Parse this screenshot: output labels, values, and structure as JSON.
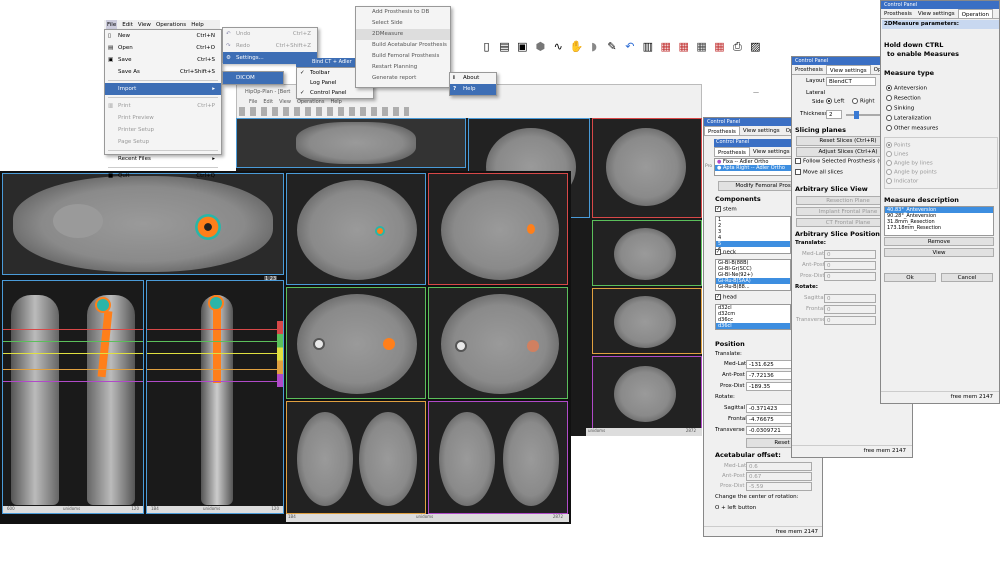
{
  "file_menu": {
    "bar": [
      "File",
      "Edit",
      "View",
      "Operations",
      "Help"
    ],
    "items": [
      {
        "label": "New",
        "shortcut": "Ctrl+N",
        "icon": "new-icon"
      },
      {
        "label": "Open",
        "shortcut": "Ctrl+O",
        "icon": "open-icon"
      },
      {
        "label": "Save",
        "shortcut": "Ctrl+S",
        "icon": "save-icon"
      },
      {
        "label": "Save As",
        "shortcut": "Ctrl+Shift+S"
      },
      {
        "label": "Import",
        "arrow": "▸"
      },
      {
        "label": "Print",
        "shortcut": "Ctrl+P"
      },
      {
        "label": "Print Preview"
      },
      {
        "label": "Printer Setup"
      },
      {
        "label": "Page Setup"
      },
      {
        "label": "Recent Files",
        "arrow": "▸"
      },
      {
        "label": "Quit",
        "shortcut": "Ctrl+Q"
      }
    ],
    "import_sub": "DICOM"
  },
  "edit_menu": {
    "items": [
      {
        "label": "Undo",
        "shortcut": "Ctrl+Z"
      },
      {
        "label": "Redo",
        "shortcut": "Ctrl+Shift+Z"
      },
      {
        "label": "Settings..."
      }
    ]
  },
  "view_menu": {
    "items": [
      "Toolbar",
      "Log Panel",
      "Control Panel"
    ],
    "window_title_fragment": "Bind CT + Adler"
  },
  "operations_menu": {
    "items": [
      "Add Prosthesis to DB",
      "Select Side",
      "2DMeasure",
      "Build Acetabular Prosthesis",
      "Build Femoral Prosthesis",
      "Restart Planning",
      "Generate report"
    ]
  },
  "help_menu": {
    "items": [
      "About",
      "Help"
    ]
  },
  "small_window": {
    "title": "HipOp-Plan - [Bert",
    "menubar": [
      "File",
      "Edit",
      "View",
      "Operations",
      "Help"
    ]
  },
  "main_view": {
    "slider_value": "1 23",
    "status": [
      {
        "left": "600",
        "center": "unidoms",
        "right": "120"
      },
      {
        "left": "1B4",
        "center": "unidoms",
        "right": "120"
      },
      {
        "left": "1B4",
        "center": "unidoms",
        "right": "2872"
      }
    ],
    "colors": {
      "prosthesis": "#ff7f1a",
      "cup": "#2ab5a8",
      "frame_blue": "#4a9bd8",
      "frame_red": "#d84848",
      "frame_green": "#5bbf5b",
      "frame_purple": "#b04ac8",
      "frame_orange": "#e0a040"
    }
  },
  "mid_panel": {
    "title": "Control Panel",
    "tabs": [
      "Prosthesis",
      "View settings",
      "Operation"
    ],
    "inner_tabs": [
      "Prosthesis",
      "View settings",
      "Op"
    ],
    "prosthesis_list": [
      "Fixa -- Adler Ortho",
      "Apta Right -- Adler Ortho"
    ],
    "modify_button": "Modify Femoral Prosthes",
    "components_header": "Components",
    "stem_label": "stem",
    "stem_items": [
      "1",
      "2",
      "3",
      "4",
      "5",
      "6"
    ],
    "neck_label": "neck",
    "neck_items": [
      "Gi-Bl-B(88B)",
      "Gi-Bl-Gr(SCC)",
      "Gi-Bl-Ne(92+)",
      "Gi-Ru-B(SAA)",
      "Gi-Ru-B(88..."
    ],
    "head_label": "head",
    "head_items": [
      "d32cl",
      "d32cm",
      "d36cc",
      "d36cl"
    ],
    "position_header": "Position",
    "translate_label": "Translate:",
    "translate": [
      {
        "label": "Med-Lat",
        "value": "-131.625"
      },
      {
        "label": "Ant-Post",
        "value": "-7.72136"
      },
      {
        "label": "Prox-Dist",
        "value": "-189.35"
      }
    ],
    "rotate_label": "Rotate:",
    "rotate": [
      {
        "label": "Sagittal",
        "value": "-0.371423"
      },
      {
        "label": "Frontal",
        "value": "-4.76675"
      },
      {
        "label": "Transverse",
        "value": "-0.0309721"
      }
    ],
    "reset": "Reset",
    "offset_header": "Acetabular offset:",
    "offset": [
      {
        "label": "Med-Lat",
        "value": "0.6"
      },
      {
        "label": "Ant-Post",
        "value": "0.67"
      },
      {
        "label": "Prox-Dist",
        "value": "-5.59"
      }
    ],
    "change_label": "Change the center of rotation:",
    "change_hint": "O + left button",
    "free_mem": "free mem 2147",
    "side_letters": [
      "Pro",
      "Tra",
      "Rot",
      "Acet",
      "T(1"
    ]
  },
  "slicing_panel": {
    "title": "Control Panel",
    "tabs": [
      "Prosthesis",
      "View settings",
      "Operatio"
    ],
    "layout_label": "Layout",
    "layout_value": "BlendCT",
    "lateral_label": "Lateral",
    "side_label": "Side",
    "left": "Left",
    "right": "Right",
    "thickness_label": "Thickness",
    "thickness_value": "2",
    "slicing_header": "Slicing planes",
    "reset_slices": "Reset Slices (Ctrl+R)",
    "adjust_slices": "Adjust Slices (Ctrl+A)",
    "follow": "Follow Selected Prosthesis (Ctrl+",
    "move_all": "Move all slices",
    "arb_view": "Arbitrary Slice View",
    "resection": "Resection Plane",
    "implant_frontal": "Implant Frontal Plane",
    "ct_frontal": "CT Frontal Plane",
    "arb_pos": "Arbitrary Slice Position",
    "translate_label": "Translate:",
    "translate": [
      "Med-Lat",
      "Ant-Post",
      "Prox-Dist"
    ],
    "rotate_label": "Rotate:",
    "rotate": [
      "Sagittal",
      "Frontal",
      "Transverse"
    ],
    "zero": "0",
    "free_mem": "free mem 2147"
  },
  "measure_panel": {
    "title": "Control Panel",
    "tabs": [
      "Prosthesis",
      "View settings",
      "Operation"
    ],
    "subtitle": "2DMeasure parameters:",
    "hold1": "Hold down CTRL",
    "hold2": "to enable Measures",
    "type_header": "Measure type",
    "types": [
      "Anteversion",
      "Resection",
      "Sinking",
      "Lateralization",
      "Other measures"
    ],
    "modes": [
      "Points",
      "Lines",
      "Angle by lines",
      "Angle by points",
      "Indicator"
    ],
    "desc_header": "Measure description",
    "desc_items": [
      "40.83°_Anteversion",
      "90.28°_Anteversion",
      "31.8mm_Resection",
      "173.18mm_Resection"
    ],
    "remove": "Remove",
    "view": "View",
    "ok": "Ok",
    "cancel": "Cancel",
    "free_mem": "free mem 2147"
  },
  "window_ctrl": [
    "—",
    "□"
  ]
}
